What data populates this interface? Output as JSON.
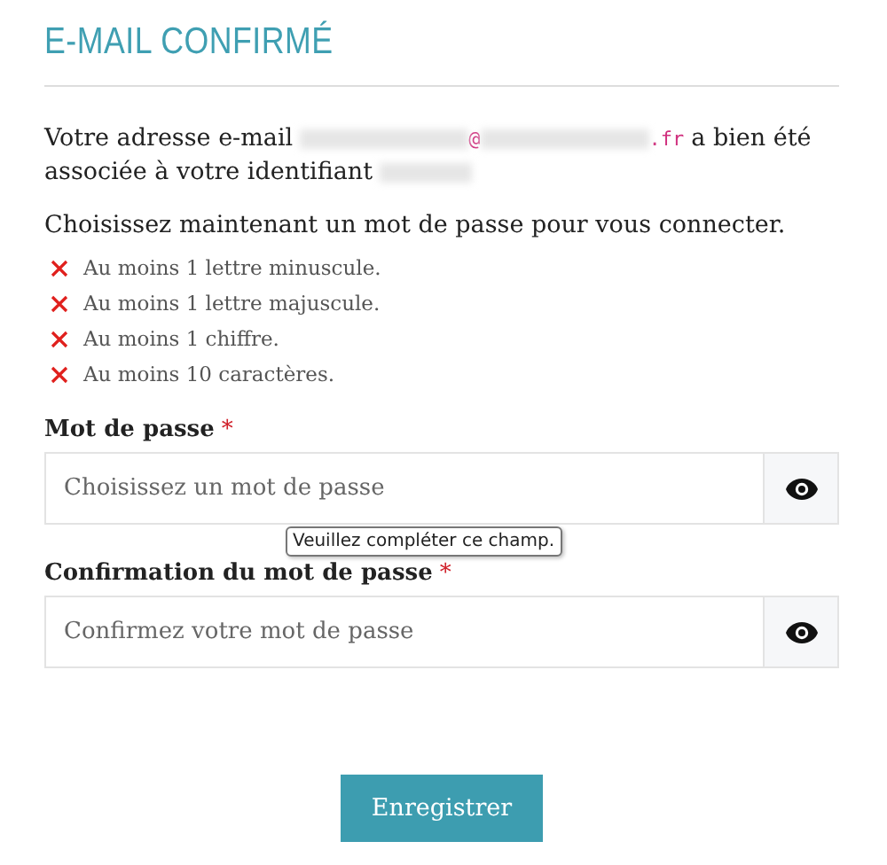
{
  "title": "E-MAIL CONFIRMÉ",
  "intro": {
    "before": "Votre adresse e-mail",
    "email": [
      {
        "kind": "redacted"
      },
      {
        "kind": "text",
        "text": "@"
      },
      {
        "kind": "redacted"
      },
      {
        "kind": "text",
        "text": ".fr"
      }
    ],
    "after": [
      "a bien été",
      "associée à votre identifiant"
    ],
    "identifier": {
      "kind": "redacted"
    }
  },
  "prompt": "Choisissez maintenant un mot de passe pour vous connecter.",
  "requirements": [
    {
      "text": "Au moins 1 lettre minuscule.",
      "met": false
    },
    {
      "text": "Au moins 1 lettre majuscule.",
      "met": false
    },
    {
      "text": "Au moins 1 chiffre.",
      "met": false
    },
    {
      "text": "Au moins 10 caractères.",
      "met": false
    }
  ],
  "fields": [
    {
      "label": "Mot de passe",
      "required_mark": "*",
      "placeholder": "Choisissez un mot de passe",
      "tooltip": "Veuillez compléter ce champ."
    },
    {
      "label": "Confirmation du mot de passe",
      "required_mark": "*",
      "placeholder": "Confirmez votre mot de passe"
    }
  ],
  "submit": "Enregistrer"
}
